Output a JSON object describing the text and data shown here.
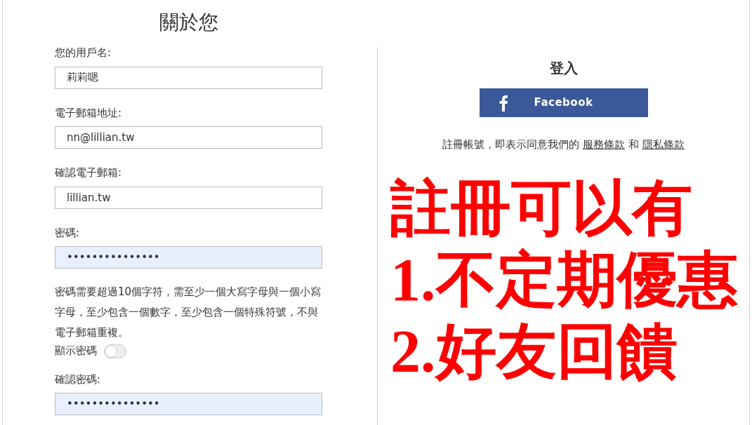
{
  "about": {
    "title": "關於您",
    "fields": [
      {
        "label": "您的用戶名:",
        "value": "莉莉嗯",
        "kind": "text"
      },
      {
        "label": "電子郵箱地址:",
        "value": "nn@lillian.tw",
        "kind": "text"
      },
      {
        "label": "確認電子郵箱:",
        "value": "lillian.tw",
        "kind": "text"
      },
      {
        "label": "密碼:",
        "value": "•••••••••••••••",
        "kind": "password",
        "hint": "密碼需要超過10個字符，需至少一個大寫字母與一個小寫字母，至少包含一個數字，至少包含一個特殊符號，不與電子郵箱重複。",
        "toggle": {
          "label": "顯示密碼",
          "on": false
        }
      },
      {
        "label": "確認密碼:",
        "value": "•••••••••••••••",
        "kind": "password"
      }
    ]
  },
  "login": {
    "title": "登入",
    "facebook_button": "Facebook",
    "terms": {
      "text": "註冊帳號，即表示同意我們的",
      "links": [
        "服務條款",
        "隱私條款"
      ],
      "joiner": "和"
    }
  },
  "annotation": [
    "註冊可以有",
    "1.不定期優惠",
    "2.好友回饋"
  ]
}
